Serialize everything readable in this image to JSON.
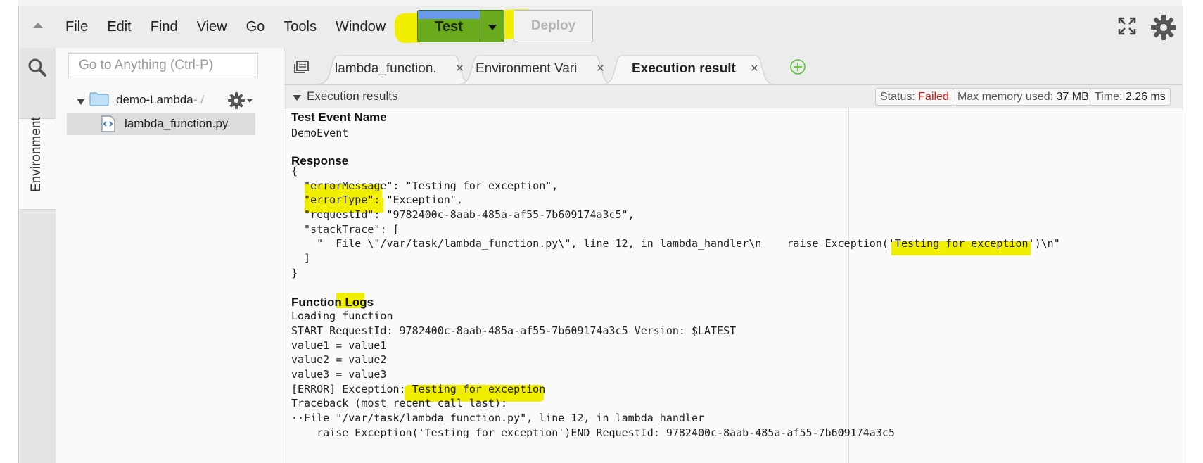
{
  "menubar": {
    "items": [
      "File",
      "Edit",
      "Find",
      "View",
      "Go",
      "Tools",
      "Window"
    ],
    "test_label": "Test",
    "deploy_label": "Deploy"
  },
  "sidebar": {
    "env_label": "Environment",
    "goto_placeholder": "Go to Anything (Ctrl-P)",
    "folder_name": "demo-Lambda",
    "folder_sep": "- /",
    "file_name": "lambda_function.py"
  },
  "tabs": [
    {
      "label": "lambda_function.",
      "active": false
    },
    {
      "label": "Environment Vari",
      "active": false
    },
    {
      "label": "Execution results",
      "active": true
    }
  ],
  "results_header": {
    "title": "Execution results",
    "status_label": "Status:",
    "status_value": "Failed",
    "memory_label": "Max memory used:",
    "memory_value": "37 MB",
    "time_label": "Time:",
    "time_value": "2.26 ms"
  },
  "results": {
    "test_event_heading": "Test Event Name",
    "test_event_value": "DemoEvent",
    "response_heading": "Response",
    "response_lines": [
      "{",
      "  \"errorMessage\": \"Testing for exception\",",
      "  \"errorType\": \"Exception\",",
      "  \"requestId\": \"9782400c-8aab-485a-af55-7b609174a3c5\",",
      "  \"stackTrace\": [",
      "    \"  File \\\"/var/task/lambda_function.py\\\", line 12, in lambda_handler\\n    raise Exception('Testing for exception')\\n\"",
      "  ]",
      "}"
    ],
    "logs_heading_prefix": "Function ",
    "logs_heading_mark": "Logs",
    "log_lines": [
      "Loading function",
      "START RequestId: 9782400c-8aab-485a-af55-7b609174a3c5 Version: $LATEST",
      "value1 = value1",
      "value2 = value2",
      "value3 = value3",
      "[ERROR] Exception: Testing for exception",
      "Traceback (most recent call last):",
      "··File \"/var/task/lambda_function.py\", line 12, in lambda_handler",
      "    raise Exception('Testing for exception')END RequestId: 9782400c-8aab-485a-af55-7b609174a3c5"
    ]
  },
  "colors": {
    "highlight": "#f2ee00",
    "test_green": "#6aab1e",
    "failed_red": "#d9221a"
  }
}
